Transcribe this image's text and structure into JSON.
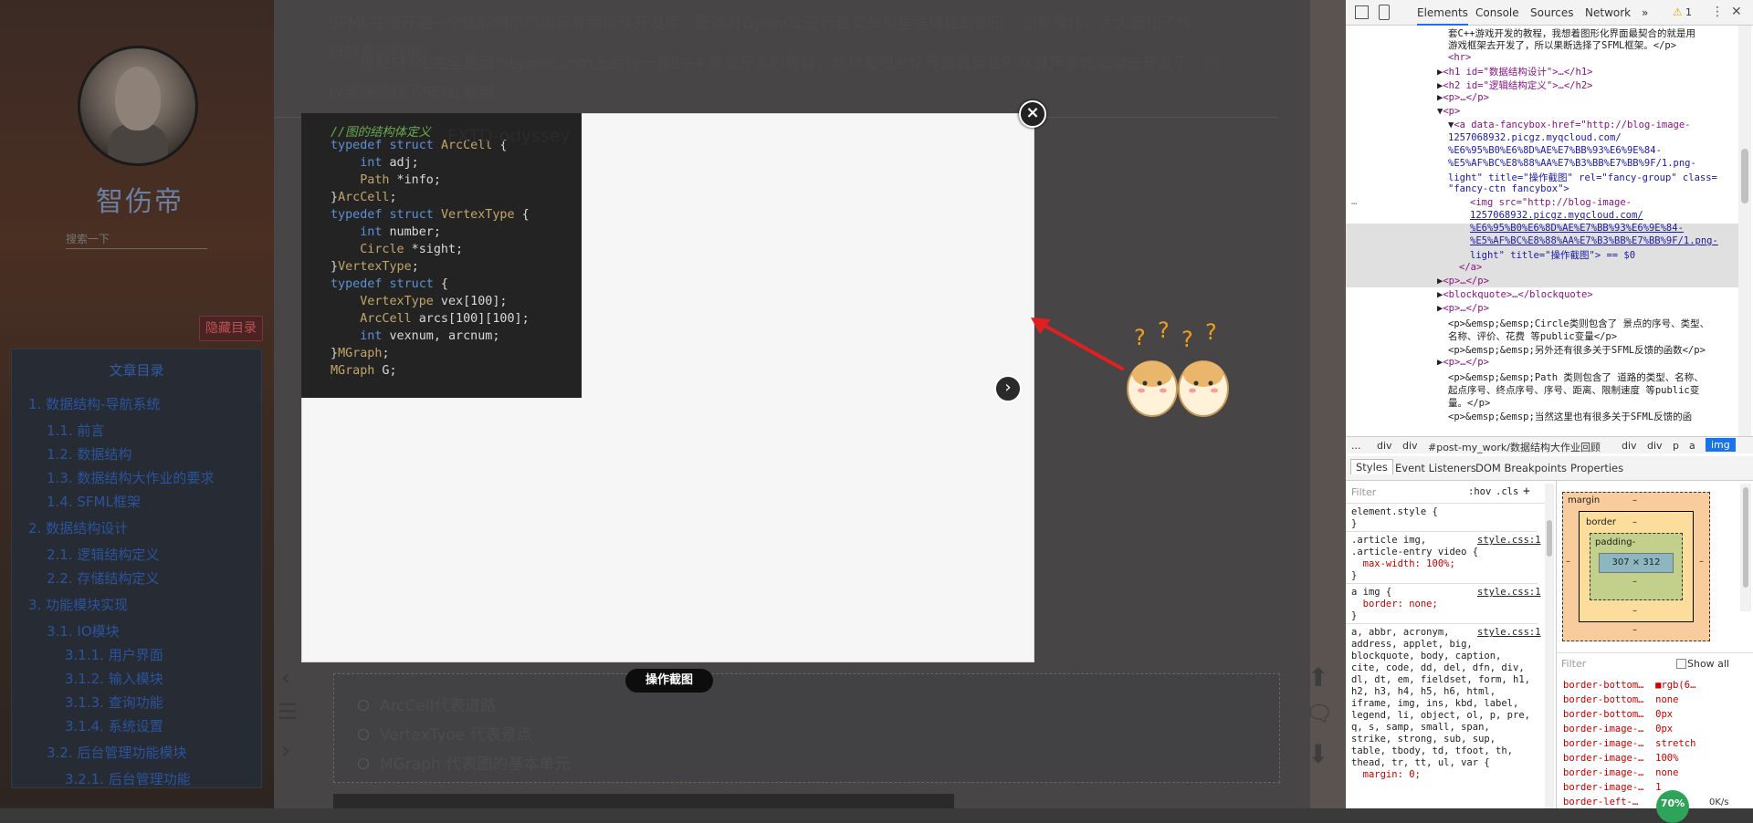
{
  "blog": {
    "author_name": "智伤帝",
    "search_placeholder": "搜索一下",
    "hide_toc_label": "隐藏目录",
    "toc": {
      "title": "文章目录",
      "items": [
        "1. 数据结构-导航系统",
        "1.1. 前言",
        "1.2. 数据结构",
        "1.3. 数据结构大作业的要求",
        "1.4. SFML框架",
        "2. 数据结构设计",
        "2.1. 逻辑结构定义",
        "2.2. 存储结构定义",
        "3. 功能模块实现",
        "3.1. IO模块",
        "3.1.1. 用户界面",
        "3.1.2. 输入模块",
        "3.1.3. 查询功能",
        "3.1.4. 系统设置",
        "3.2. 后台管理功能模块",
        "3.2.1. 后台管理功能"
      ]
    },
    "article": {
      "para1_line1": "SFML在图开避一个比较精仍的图形界面游戏开发库，是远对OpenGL进行最文头现里强周接的图形，图数操作，大大高化了代",
      "para1_line2": "码的复杂程度。",
      "para2_line1": "接触SFML完全是因为Lynda.com上面有一套C++游戏开发的教程，我想着图形化界面最契合的就是用游戏框架去开发了，所",
      "para2_line2": "以果断选择了SFML框架。",
      "list_items": [
        "ArcCell代表道路",
        "VertexTyoe 代表景点",
        "MGraph 代表图的基本单元"
      ]
    }
  },
  "fancybox": {
    "watermark": "FXTD-odyssey",
    "caption": "操作截图",
    "close_glyph": "×",
    "next_glyph": "›",
    "code_lines": [
      "//图的结构体定义",
      "typedef struct ArcCell {",
      "    int adj;",
      "    Path *info;",
      "}ArcCell;",
      "typedef struct VertexType {",
      "    int number;",
      "    Circle *sight;",
      "}VertexType;",
      "typedef struct {",
      "    VertexType vex[100];",
      "    ArcCell arcs[100][100];",
      "    int vexnum, arcnum;",
      "}MGraph;",
      "MGraph G;"
    ]
  },
  "devtools": {
    "tabs": [
      "Elements",
      "Console",
      "Sources",
      "Network",
      "»"
    ],
    "warning_count": "1",
    "dom_lines": [
      "套C++游戏开发的教程，我想着图形化界面最契合的就是用",
      "游戏框架去开发了，所以果断选择了SFML框架。</p>",
      "<hr>",
      "<h1 id=\"数据结构设计\">…</h1>",
      "<h2 id=\"逻辑结构定义\">…</h2>",
      "<p>…</p>",
      "<p>",
      "<a data-fancybox-href=\"http://blog-image-",
      "1257068932.picgz.myqcloud.com/",
      "%E6%95%B0%E6%8D%AE%E7%BB%93%E6%9E%84-",
      "%E5%AF%BC%E8%88%AA%E7%B3%BB%E7%BB%9F/1.png-",
      "light\" title=\"操作截图\" rel=\"fancy-group\" class=",
      "\"fancy-ctn fancybox\">",
      "<img src=\"http://blog-image-",
      "1257068932.picgz.myqcloud.com/",
      "%E6%95%B0%E6%8D%AE%E7%BB%93%E6%9E%84-",
      "%E5%AF%BC%E8%88%AA%E7%B3%BB%E7%BB%9F/1.png-",
      "light\" title=\"操作截图\"> == $0",
      "</a>",
      "<p>…</p>",
      "<blockquote>…</blockquote>",
      "<p>…</p>",
      "<p>&emsp;&emsp;Circle类则包含了 景点的序号、类型、",
      "名称、评价、花费 等public变量</p>",
      "<p>&emsp;&emsp;另外还有很多关于SFML反馈的函数</p>",
      "<p>…</p>",
      "<p>&emsp;&emsp;Path 类则包含了 道路的类型、名称、",
      "起点序号、终点序号、序号、距离、限制速度 等public变",
      "量。</p>",
      "<p>&emsp;&emsp;当然这里也有很多关于SFML反馈的函"
    ],
    "breadcrumb": [
      "...",
      "div",
      "div",
      "#post-my_work/数据结构大作业回顾",
      "div",
      "div",
      "p",
      "a",
      "img"
    ],
    "style_tabs": [
      "Styles",
      "Event Listeners",
      "DOM Breakpoints",
      "Properties"
    ],
    "filter_placeholder": "Filter",
    "hov": ":hov",
    "cls": ".cls",
    "plus": "+",
    "styles_lines": [
      "element.style {",
      "}",
      ".article img,",
      ".article-entry video {",
      "  max-width: 100%;",
      "}",
      "a img {",
      "  border: none;",
      "}",
      "a, abbr, acronym,",
      "address, applet, big,",
      "blockquote, body, caption,",
      "cite, code, dd, del, dfn, div,",
      "dl, dt, em, fieldset, form, h1,",
      "h2, h3, h4, h5, h6, html,",
      "iframe, img, ins, kbd, label,",
      "legend, li, object, ol, p, pre,",
      "q, s, samp, small, span,",
      "strike, strong, sub, sup,",
      "table, tbody, td, tfoot, th,",
      "thead, tr, tt, ul, var {",
      "  margin: 0;"
    ],
    "style_source": "style.css:1",
    "box_model": {
      "margin_label": "margin",
      "border_label": "border",
      "padding_label": "padding-",
      "content_size": "307 × 312",
      "dash": "–"
    },
    "computed_filter": "Filter",
    "show_all": "Show all",
    "computed_props": [
      "border-bottom…  ■rgb(6…",
      "border-bottom…  none",
      "border-bottom…  0px",
      "border-image-…  0px",
      "border-image-…  stretch",
      "border-image-…  100%",
      "border-image-…  none",
      "border-image-…  1",
      "border-left-…"
    ],
    "status_badge": "70%",
    "net_speed": "0K/s"
  }
}
